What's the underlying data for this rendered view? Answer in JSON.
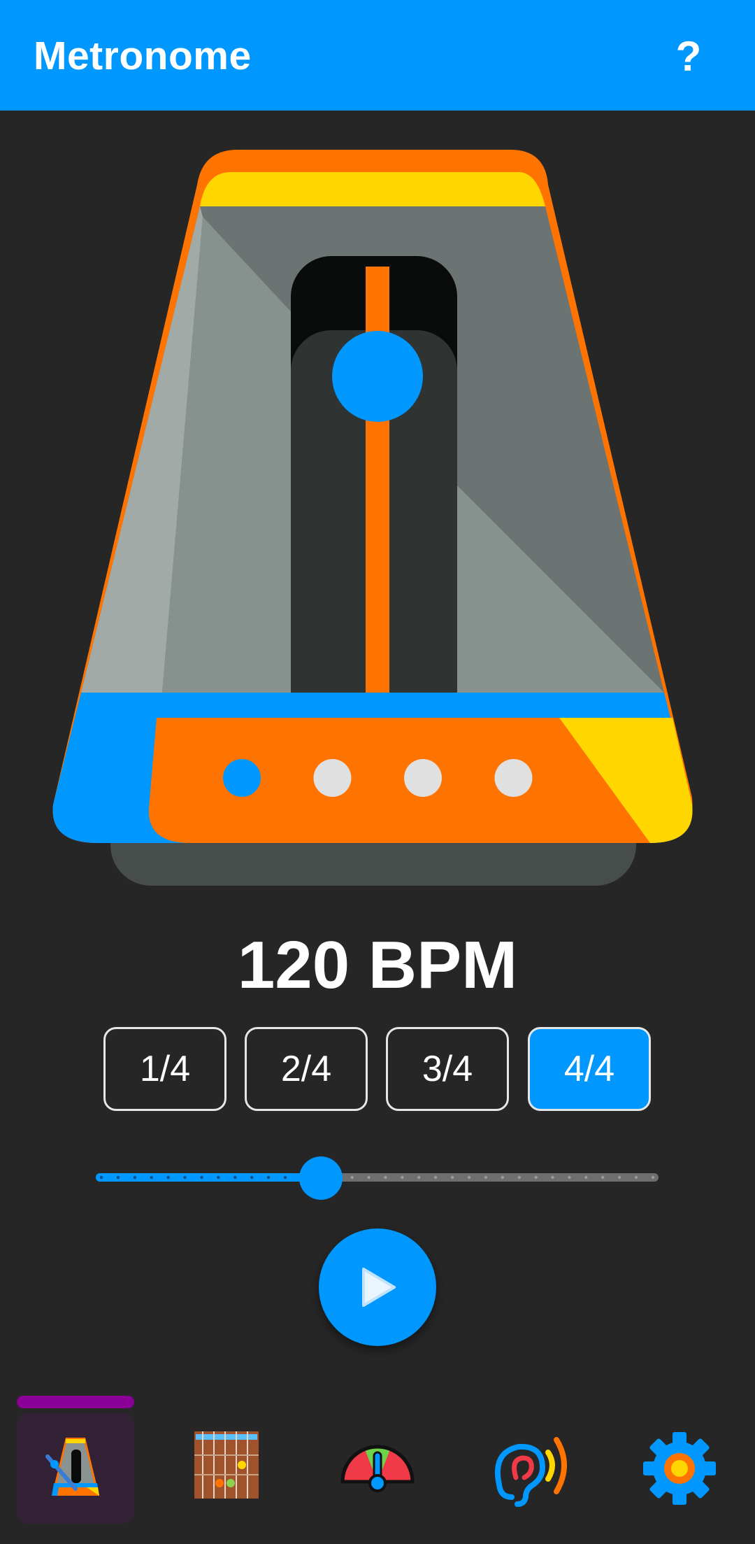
{
  "appbar": {
    "title": "Metronome",
    "help_label": "?"
  },
  "metronome": {
    "beat_count": 4,
    "current_beat": 1
  },
  "tempo": {
    "bpm_text": "120 BPM",
    "slider_fraction": 0.4
  },
  "time_signatures": [
    {
      "label": "1/4",
      "active": false
    },
    {
      "label": "2/4",
      "active": false
    },
    {
      "label": "3/4",
      "active": false
    },
    {
      "label": "4/4",
      "active": true
    }
  ],
  "play_icon": "play-icon",
  "bottom_nav": [
    {
      "name": "metronome",
      "icon": "metronome-icon",
      "active": true
    },
    {
      "name": "chords",
      "icon": "guitar-fretboard-icon",
      "active": false
    },
    {
      "name": "tuner",
      "icon": "tuner-gauge-icon",
      "active": false
    },
    {
      "name": "ear-training",
      "icon": "ear-icon",
      "active": false
    },
    {
      "name": "settings",
      "icon": "gear-icon",
      "active": false
    }
  ],
  "colors": {
    "accent": "#0098fe",
    "orange": "#ff7300",
    "yellow": "#ffd600",
    "nav_active": "#8a0096",
    "background": "#262626"
  }
}
